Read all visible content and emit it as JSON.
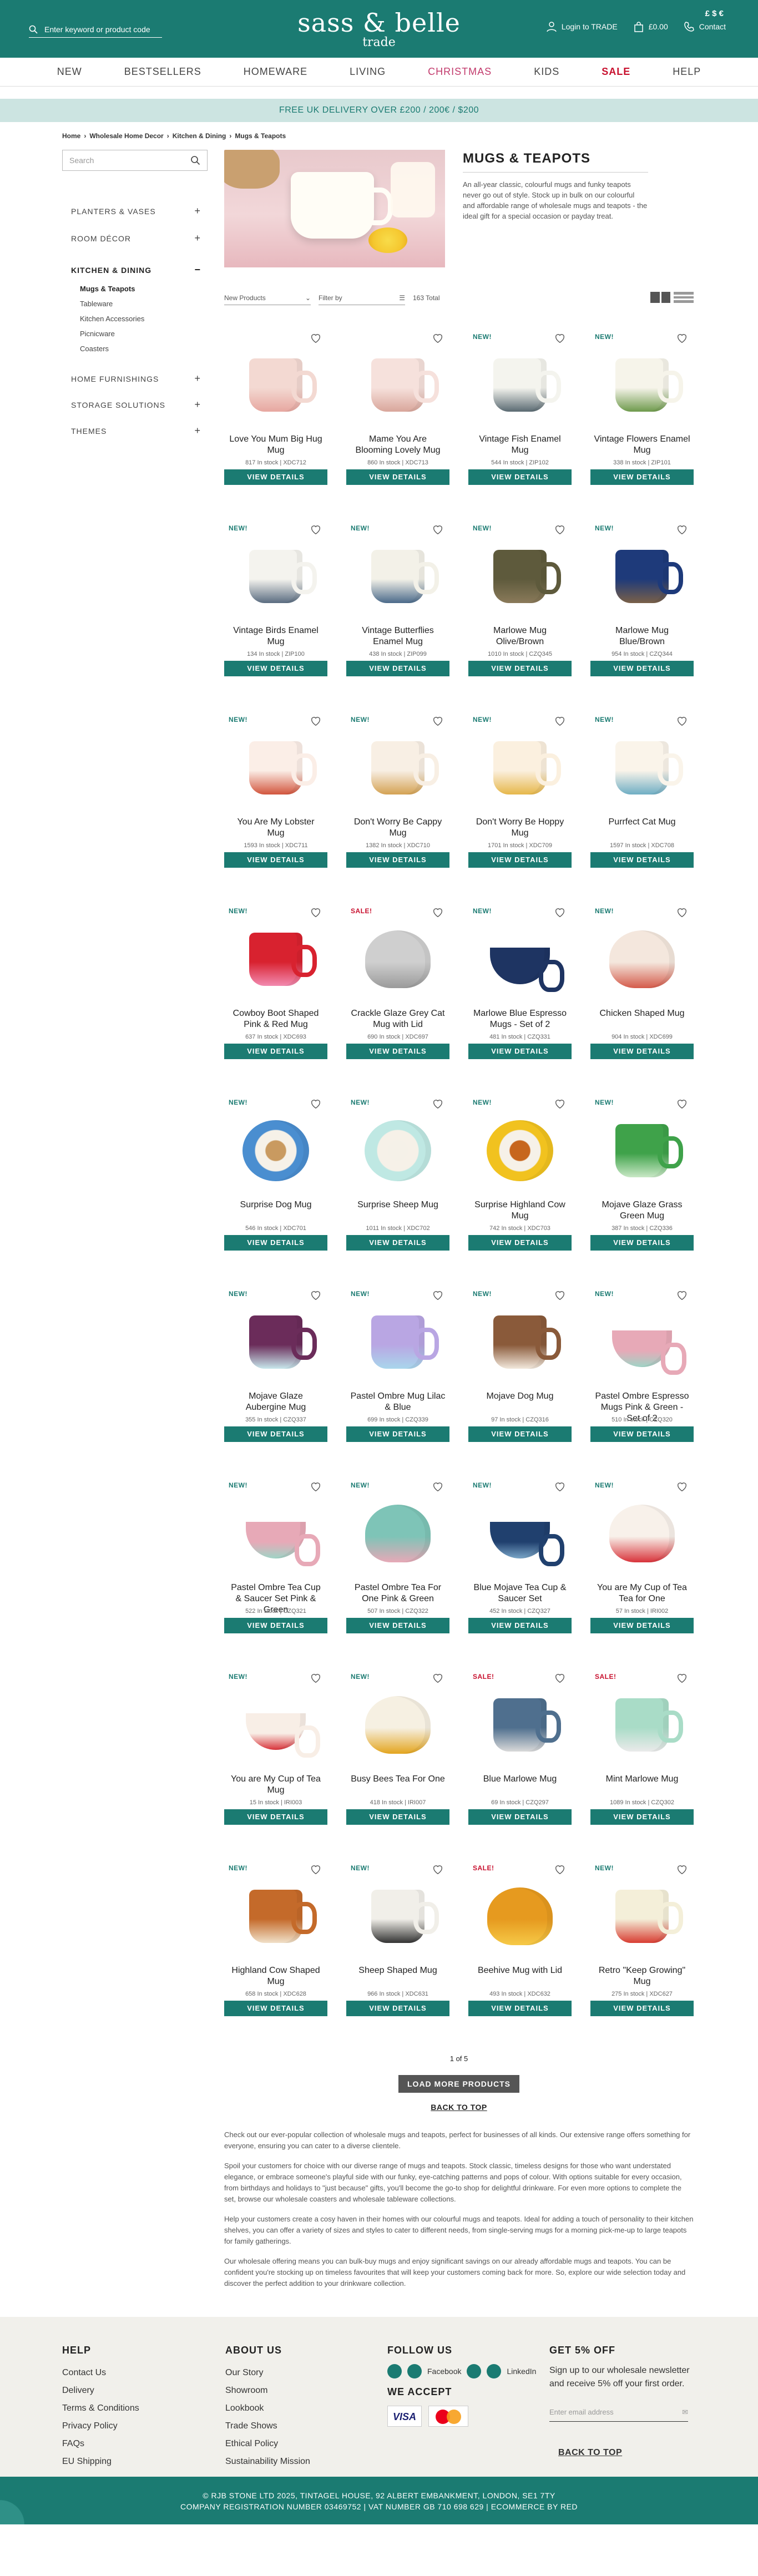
{
  "header": {
    "search_placeholder": "Enter keyword or product code",
    "logo_line1": "sass & belle",
    "logo_line2": "trade",
    "currency_symbols": "£ $ €",
    "login_label": "Login to TRADE",
    "basket_label": "£0.00",
    "contact_label": "Contact"
  },
  "nav": [
    {
      "label": "NEW",
      "style": "normal"
    },
    {
      "label": "BESTSELLERS",
      "style": "normal"
    },
    {
      "label": "HOMEWARE",
      "style": "normal"
    },
    {
      "label": "LIVING",
      "style": "normal"
    },
    {
      "label": "CHRISTMAS",
      "style": "pink"
    },
    {
      "label": "KIDS",
      "style": "normal"
    },
    {
      "label": "SALE",
      "style": "red"
    },
    {
      "label": "HELP",
      "style": "normal"
    }
  ],
  "promo": "FREE UK DELIVERY OVER £200 / 200€ / $200",
  "breadcrumb": [
    "Home",
    "Wholesale Home Decor",
    "Kitchen & Dining",
    "Mugs & Teapots"
  ],
  "sidebar": {
    "search_placeholder": "Search",
    "categories": [
      {
        "label": "PLANTERS & VASES",
        "toggle": "+"
      },
      {
        "label": "ROOM DÉCOR",
        "toggle": "+"
      },
      {
        "label": "KITCHEN & DINING",
        "toggle": "−",
        "active": true
      },
      {
        "label": "HOME FURNISHINGS",
        "toggle": "+"
      },
      {
        "label": "STORAGE SOLUTIONS",
        "toggle": "+"
      },
      {
        "label": "THEMES",
        "toggle": "+"
      }
    ],
    "subcategories": [
      "Mugs & Teapots",
      "Tableware",
      "Kitchen Accessories",
      "Picnicware",
      "Coasters"
    ]
  },
  "category": {
    "title": "MUGS & TEAPOTS",
    "description": "An all-year classic, colourful mugs and funky teapots never go out of style. Stock up in bulk on our colourful and affordable range of wholesale mugs and teapots - the ideal gift for a special occasion or payday treat."
  },
  "toolbar": {
    "sort_label": "New Products",
    "filter_label": "Filter by",
    "total": "163 Total"
  },
  "view_details_label": "VIEW DETAILS",
  "products": [
    {
      "badge": "",
      "name": "Love You Mum Big Hug Mug",
      "stock": "817 In stock | XDC712",
      "shape": "mug",
      "color": "#f3d9d2",
      "accent": "#e7a7a0"
    },
    {
      "badge": "",
      "name": "Mame You Are Blooming Lovely Mug",
      "stock": "860 In stock | XDC713",
      "shape": "mug",
      "color": "#f6e1dc",
      "accent": "#d9a69b"
    },
    {
      "badge": "NEW!",
      "name": "Vintage Fish Enamel Mug",
      "stock": "544 In stock | ZIP102",
      "shape": "mug",
      "color": "#f4f4ee",
      "accent": "#5a6a72"
    },
    {
      "badge": "NEW!",
      "name": "Vintage Flowers Enamel Mug",
      "stock": "338 In stock | ZIP101",
      "shape": "mug",
      "color": "#f6f4ea",
      "accent": "#6e9a4c"
    },
    {
      "badge": "NEW!",
      "name": "Vintage Birds Enamel Mug",
      "stock": "134 In stock | ZIP100",
      "shape": "mug",
      "color": "#f4f3ee",
      "accent": "#5a6c80"
    },
    {
      "badge": "NEW!",
      "name": "Vintage Butterflies Enamel Mug",
      "stock": "438 In stock | ZIP099",
      "shape": "mug",
      "color": "#f3f1e8",
      "accent": "#4b6a8a"
    },
    {
      "badge": "NEW!",
      "name": "Marlowe Mug Olive/Brown",
      "stock": "1010 In stock | CZQ345",
      "shape": "mug",
      "color": "#5e5a3c",
      "accent": "#8a7a5a"
    },
    {
      "badge": "NEW!",
      "name": "Marlowe Mug Blue/Brown",
      "stock": "954 In stock | CZQ344",
      "shape": "mug",
      "color": "#1e3a7a",
      "accent": "#7a6048"
    },
    {
      "badge": "NEW!",
      "name": "You Are My Lobster Mug",
      "stock": "1593 In stock | XDC711",
      "shape": "mug",
      "color": "#fbeee7",
      "accent": "#d2553d"
    },
    {
      "badge": "NEW!",
      "name": "Don't Worry Be Cappy Mug",
      "stock": "1382 In stock | XDC710",
      "shape": "mug",
      "color": "#f8efe4",
      "accent": "#d4a253"
    },
    {
      "badge": "NEW!",
      "name": "Don't Worry Be Hoppy Mug",
      "stock": "1701 In stock | XDC709",
      "shape": "mug",
      "color": "#fbf0df",
      "accent": "#e6b74a"
    },
    {
      "badge": "NEW!",
      "name": "Purrfect Cat Mug",
      "stock": "1597 In stock | XDC708",
      "shape": "mug",
      "color": "#faf4ea",
      "accent": "#6faec4"
    },
    {
      "badge": "NEW!",
      "name": "Cowboy Boot Shaped Pink & Red Mug",
      "stock": "637 In stock | XDC693",
      "shape": "mug",
      "color": "#d8222f",
      "accent": "#f28ab0"
    },
    {
      "badge": "SALE!",
      "name": "Crackle Glaze Grey Cat Mug with Lid",
      "stock": "690 In stock | XDC697",
      "shape": "pot",
      "color": "#cfcfcf",
      "accent": "#9a9a9a"
    },
    {
      "badge": "NEW!",
      "name": "Marlowe Blue Espresso Mugs - Set of 2",
      "stock": "481 In stock | CZQ331",
      "shape": "cup",
      "color": "#1e3462",
      "accent": "#1e3462"
    },
    {
      "badge": "NEW!",
      "name": "Chicken Shaped Mug",
      "stock": "904 In stock | XDC699",
      "shape": "pot",
      "color": "#f4e7dd",
      "accent": "#d45a4a"
    },
    {
      "badge": "NEW!",
      "name": "Surprise Dog Mug",
      "stock": "546 In stock | XDC701",
      "shape": "bowl",
      "color": "#4a8ed0",
      "accent": "#c99a60"
    },
    {
      "badge": "NEW!",
      "name": "Surprise Sheep Mug",
      "stock": "1011 In stock | XDC702",
      "shape": "bowl",
      "color": "#bfe8e3",
      "accent": "#f5f1e8"
    },
    {
      "badge": "NEW!",
      "name": "Surprise Highland Cow Mug",
      "stock": "742 In stock | XDC703",
      "shape": "bowl",
      "color": "#f1c21f",
      "accent": "#c7661d"
    },
    {
      "badge": "NEW!",
      "name": "Mojave Glaze Grass Green Mug",
      "stock": "387 In stock | CZQ336",
      "shape": "mug",
      "color": "#3fa24a",
      "accent": "#c9e8c6"
    },
    {
      "badge": "NEW!",
      "name": "Mojave Glaze Aubergine Mug",
      "stock": "355 In stock | CZQ337",
      "shape": "mug",
      "color": "#6b2c5a",
      "accent": "#c7e7ec"
    },
    {
      "badge": "NEW!",
      "name": "Pastel Ombre Mug Lilac & Blue",
      "stock": "699 In stock | CZQ339",
      "shape": "mug",
      "color": "#b9a6e3",
      "accent": "#a9d6ec"
    },
    {
      "badge": "NEW!",
      "name": "Mojave Dog Mug",
      "stock": "97 In stock | CZQ316",
      "shape": "mug",
      "color": "#8a5a3a",
      "accent": "#f2e8dc"
    },
    {
      "badge": "NEW!",
      "name": "Pastel Ombre Espresso Mugs Pink & Green - Set of 2",
      "stock": "510 In stock | CZQ320",
      "shape": "cup",
      "color": "#e7a9b7",
      "accent": "#9fd4c6"
    },
    {
      "badge": "NEW!",
      "name": "Pastel Ombre Tea Cup & Saucer Set Pink & Green",
      "stock": "522 In stock | CZQ321",
      "shape": "cup",
      "color": "#e7a9b7",
      "accent": "#9fd4c6"
    },
    {
      "badge": "NEW!",
      "name": "Pastel Ombre Tea For One Pink & Green",
      "stock": "507 In stock | CZQ322",
      "shape": "pot",
      "color": "#7ec4b7",
      "accent": "#e7a9b7"
    },
    {
      "badge": "NEW!",
      "name": "Blue Mojave Tea Cup & Saucer Set",
      "stock": "452 In stock | CZQ327",
      "shape": "cup",
      "color": "#20406e",
      "accent": "#7aa6c8"
    },
    {
      "badge": "NEW!",
      "name": "You are My Cup of Tea Tea for One",
      "stock": "57 In stock | IRI002",
      "shape": "pot",
      "color": "#f8f1ea",
      "accent": "#d8333a"
    },
    {
      "badge": "NEW!",
      "name": "You are My Cup of Tea Mug",
      "stock": "15 In stock | IRI003",
      "shape": "cup",
      "color": "#f8eee6",
      "accent": "#d8333a"
    },
    {
      "badge": "NEW!",
      "name": "Busy Bees Tea For One",
      "stock": "418 In stock | IRI007",
      "shape": "pot",
      "color": "#f6f0e2",
      "accent": "#e3a51f"
    },
    {
      "badge": "SALE!",
      "name": "Blue Marlowe Mug",
      "stock": "69 In stock | CZQ297",
      "shape": "mug",
      "color": "#4f6f8e",
      "accent": "#d9d9d9"
    },
    {
      "badge": "SALE!",
      "name": "Mint Marlowe Mug",
      "stock": "1089 In stock | CZQ302",
      "shape": "mug",
      "color": "#a9dcc7",
      "accent": "#eaeaea"
    },
    {
      "badge": "NEW!",
      "name": "Highland Cow Shaped Mug",
      "stock": "658 In stock | XDC628",
      "shape": "mug",
      "color": "#c46a2a",
      "accent": "#f0e0c8"
    },
    {
      "badge": "NEW!",
      "name": "Sheep Shaped Mug",
      "stock": "966 In stock | XDC631",
      "shape": "mug",
      "color": "#f1efe9",
      "accent": "#333333"
    },
    {
      "badge": "SALE!",
      "name": "Beehive Mug with Lid",
      "stock": "493 In stock | XDC632",
      "shape": "pot",
      "color": "#e69a1f",
      "accent": "#f6c947"
    },
    {
      "badge": "NEW!",
      "name": "Retro \"Keep Growing\" Mug",
      "stock": "275 In stock | XDC627",
      "shape": "mug",
      "color": "#f4efd9",
      "accent": "#d83d32"
    }
  ],
  "pagination": {
    "label": "1 of 5",
    "load_more": "LOAD MORE PRODUCTS",
    "back_to_top": "BACK TO TOP"
  },
  "seo_text": [
    "Check out our ever-popular collection of wholesale mugs and teapots, perfect for businesses of all kinds. Our extensive range offers something for everyone, ensuring you can cater to a diverse clientele.",
    "Spoil your customers for choice with our diverse range of mugs and teapots. Stock classic, timeless designs for those who want understated elegance, or embrace someone's playful side with our funky, eye-catching patterns and pops of colour. With options suitable for every occasion, from birthdays and holidays to \"just because\" gifts, you'll become the go-to shop for delightful drinkware. For even more options to complete the set, browse our wholesale coasters and wholesale tableware collections.",
    "Help your customers create a cosy haven in their homes with our colourful mugs and teapots. Ideal for adding a touch of personality to their kitchen shelves, you can offer a variety of sizes and styles to cater to different needs, from single-serving mugs for a morning pick-me-up to large teapots for family gatherings.",
    "Our wholesale offering means you can bulk-buy mugs and enjoy significant savings on our already affordable mugs and teapots. You can be confident you're stocking up on timeless favourites that will keep your customers coming back for more. So, explore our wide selection today and discover the perfect addition to your drinkware collection."
  ],
  "footer": {
    "help_title": "HELP",
    "help_links": [
      "Contact Us",
      "Delivery",
      "Terms & Conditions",
      "Privacy Policy",
      "FAQs",
      "EU Shipping"
    ],
    "about_title": "ABOUT US",
    "about_links": [
      "Our Story",
      "Showroom",
      "Lookbook",
      "Trade Shows",
      "Ethical Policy",
      "Sustainability Mission"
    ],
    "follow_title": "FOLLOW US",
    "social_labels": [
      "Facebook",
      "LinkedIn"
    ],
    "accept_title": "WE ACCEPT",
    "visa_label": "VISA",
    "news_title": "GET 5% OFF",
    "news_text": "Sign up to our wholesale newsletter and receive 5% off your first order.",
    "email_placeholder": "Enter email address",
    "back_to_top": "BACK TO TOP"
  },
  "bottom_bar": {
    "line1": "© RJB STONE LTD 2025, TINTAGEL HOUSE, 92 ALBERT EMBANKMENT, LONDON, SE1 7TY",
    "line2": "COMPANY REGISTRATION NUMBER 03469752 | VAT NUMBER GB 710 698 629 | ECOMMERCE BY RED"
  },
  "colors": {
    "brand": "#1b7b72",
    "promo_bg": "#cce4e1",
    "sale": "#c8102e",
    "christmas": "#c23a6c"
  }
}
